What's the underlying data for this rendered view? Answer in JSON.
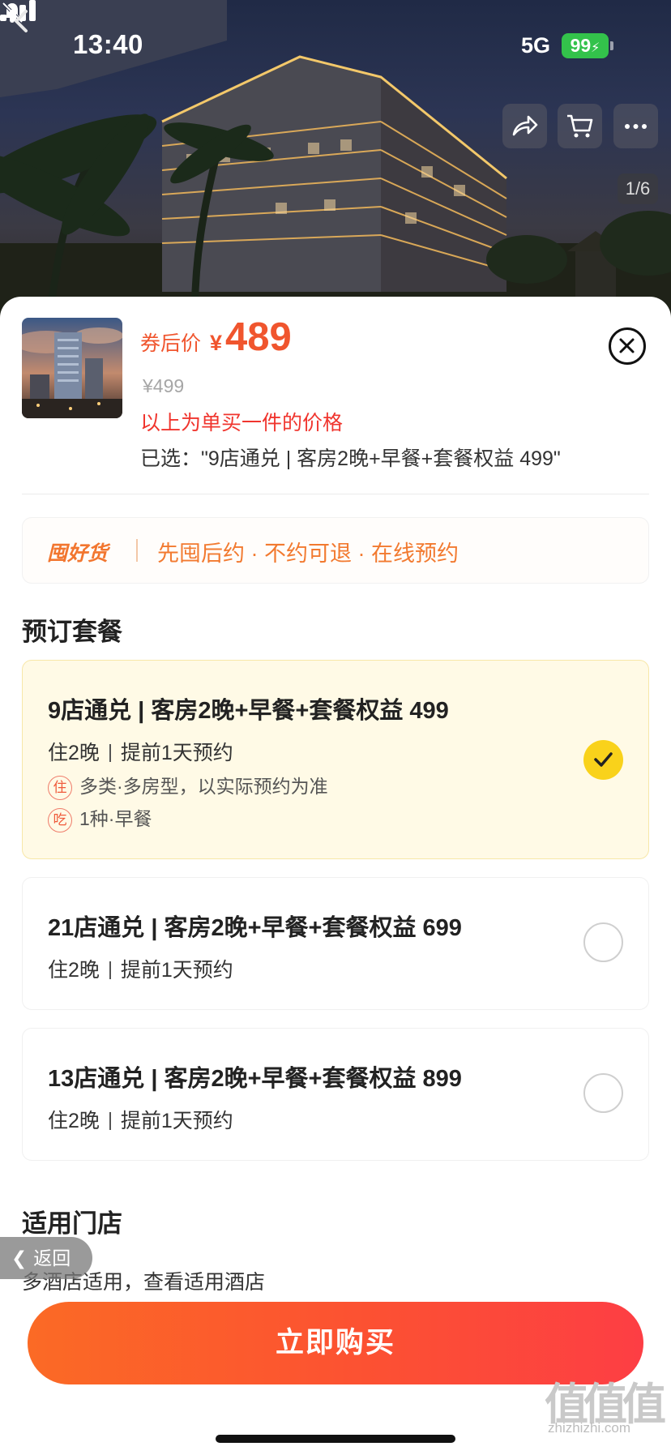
{
  "status_bar": {
    "time": "13:40",
    "network": "5G",
    "battery": "99"
  },
  "header": {
    "image_counter": "1/6"
  },
  "summary": {
    "price_prefix": "券后价",
    "currency": "¥",
    "price": "489",
    "original_price": "¥499",
    "price_note": "以上为单买一件的价格",
    "selected": "已选：\"9店通兑 | 客房2晚+早餐+套餐权益 499\""
  },
  "promo": {
    "brand": "囤好货",
    "text": "先囤后约 · 不约可退 · 在线预约"
  },
  "packages_section": {
    "title": "预订套餐"
  },
  "packages": [
    {
      "title": "9店通兑 | 客房2晚+早餐+套餐权益 499",
      "nights": "住2晚",
      "advance": "提前1天预约",
      "stay_badge": "住",
      "stay_text": "多类·多房型，以实际预约为准",
      "eat_badge": "吃",
      "eat_text": "1种·早餐",
      "selected": true
    },
    {
      "title": "21店通兑 | 客房2晚+早餐+套餐权益 699",
      "nights": "住2晚",
      "advance": "提前1天预约",
      "selected": false
    },
    {
      "title": "13店通兑 | 客房2晚+早餐+套餐权益 899",
      "nights": "住2晚",
      "advance": "提前1天预约",
      "selected": false
    }
  ],
  "stores_section": {
    "title": "适用门店",
    "text": "多酒店适用，查看适用酒店"
  },
  "back_pill": {
    "label": "返回"
  },
  "buy_button": {
    "label": "立即购买"
  },
  "watermark": {
    "text": "值值值",
    "url": "zhizhizhi.com"
  },
  "colors": {
    "accent": "#f0552e",
    "check": "#f9d21b",
    "promo": "#f27a30",
    "buy_start": "#fb6a25",
    "buy_end": "#fd3e44"
  }
}
